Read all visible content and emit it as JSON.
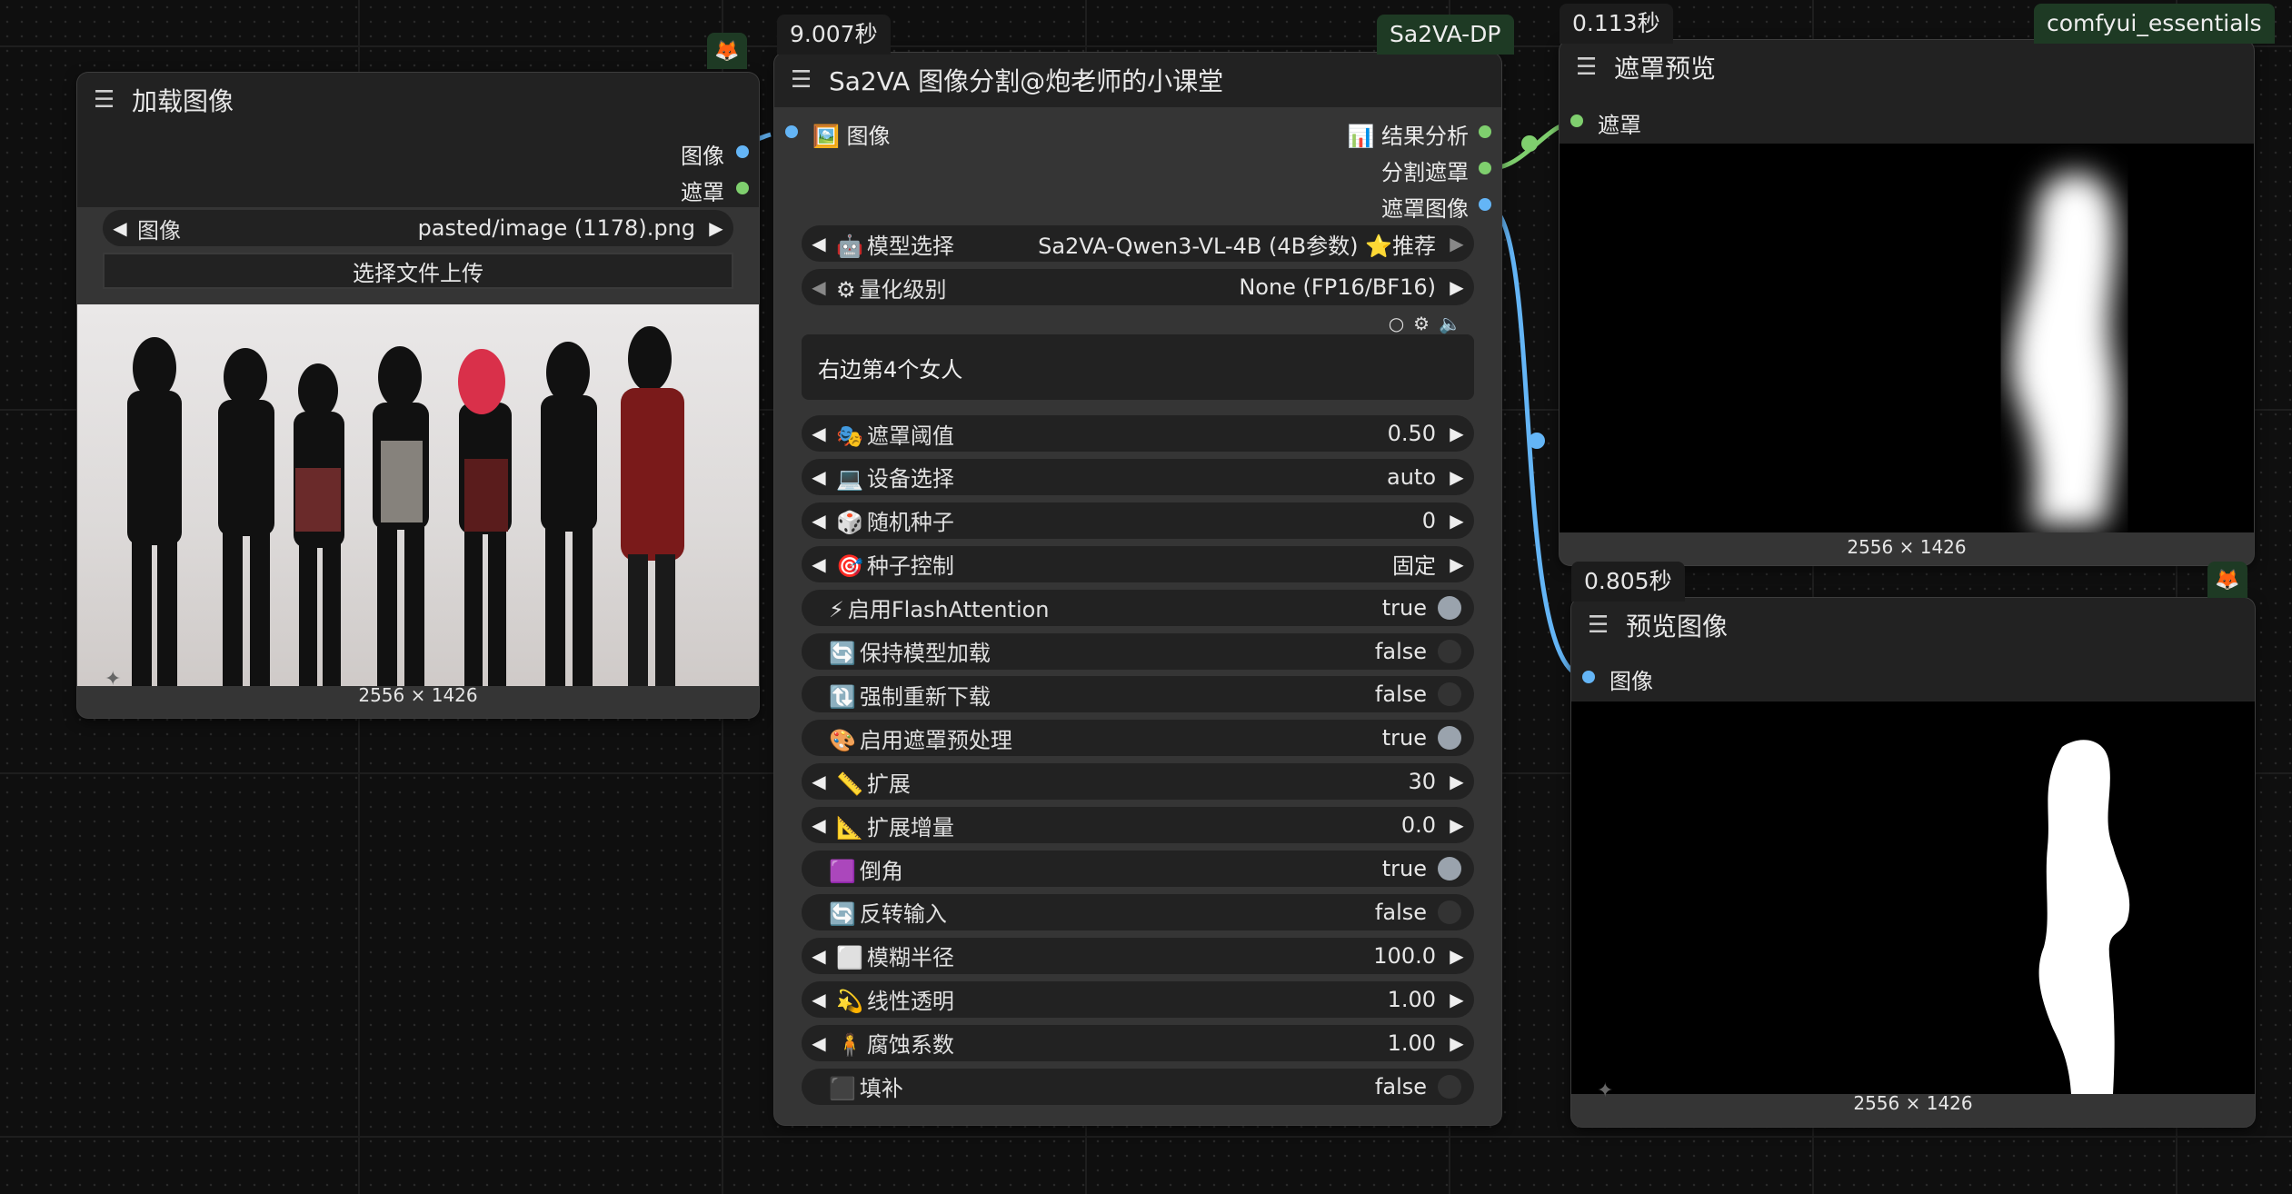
{
  "badges": {
    "sa2va_time": "9.007秒",
    "mask_time": "0.113秒",
    "preview_time": "0.805秒",
    "sa2va_tag": "Sa2VA-DP",
    "essentials_tag": "comfyui_essentials"
  },
  "load_image": {
    "title": "加载图像",
    "outputs": [
      "图像",
      "遮罩"
    ],
    "image_widget": {
      "label": "图像",
      "value": "pasted/image (1178).png"
    },
    "upload_button": "选择文件上传",
    "dims": "2556 × 1426"
  },
  "sa2va": {
    "title": "Sa2VA 图像分割@炮老师的小课堂",
    "input_label": "🖼️ 图像",
    "outputs": [
      "📊 结果分析",
      "分割遮罩",
      "遮罩图像"
    ],
    "model_label": "模型选择",
    "model_value": "Sa2VA-Qwen3-VL-4B (4B参数) ⭐推荐",
    "quant_label": "量化级别",
    "quant_value": "None (FP16/BF16)",
    "prompt_text": "右边第4个女人",
    "widgets": [
      {
        "icon": "🎭",
        "label": "遮罩阈值",
        "value": "0.50",
        "type": "number"
      },
      {
        "icon": "💻",
        "label": "设备选择",
        "value": "auto",
        "type": "combo"
      },
      {
        "icon": "🎲",
        "label": "随机种子",
        "value": "0",
        "type": "number"
      },
      {
        "icon": "🎯",
        "label": "种子控制",
        "value": "固定",
        "type": "combo"
      },
      {
        "icon": "⚡",
        "label": "启用FlashAttention",
        "value": "true",
        "type": "toggle",
        "on": true
      },
      {
        "icon": "🔄",
        "label": "保持模型加载",
        "value": "false",
        "type": "toggle",
        "on": false
      },
      {
        "icon": "🔃",
        "label": "强制重新下载",
        "value": "false",
        "type": "toggle",
        "on": false
      },
      {
        "icon": "🎨",
        "label": "启用遮罩预处理",
        "value": "true",
        "type": "toggle",
        "on": true
      },
      {
        "icon": "📏",
        "label": "扩展",
        "value": "30",
        "type": "number"
      },
      {
        "icon": "📐",
        "label": "扩展增量",
        "value": "0.0",
        "type": "number"
      },
      {
        "icon": "🟪",
        "label": "倒角",
        "value": "true",
        "type": "toggle",
        "on": true
      },
      {
        "icon": "🔄",
        "label": "反转输入",
        "value": "false",
        "type": "toggle",
        "on": false
      },
      {
        "icon": "⬜",
        "label": "模糊半径",
        "value": "100.0",
        "type": "number"
      },
      {
        "icon": "💫",
        "label": "线性透明",
        "value": "1.00",
        "type": "number"
      },
      {
        "icon": "🧍",
        "label": "腐蚀系数",
        "value": "1.00",
        "type": "number"
      },
      {
        "icon": "⬛",
        "label": "填补",
        "value": "false",
        "type": "toggle",
        "on": false
      }
    ]
  },
  "mask_preview": {
    "title": "遮罩预览",
    "input_label": "遮罩",
    "dims": "2556 × 1426"
  },
  "preview_image": {
    "title": "预览图像",
    "input_label": "图像",
    "dims": "2556 × 1426"
  },
  "colors": {
    "image_socket": "#64b5f6",
    "mask_socket": "#7fcf6e",
    "tag_bg": "#1e3a24"
  }
}
